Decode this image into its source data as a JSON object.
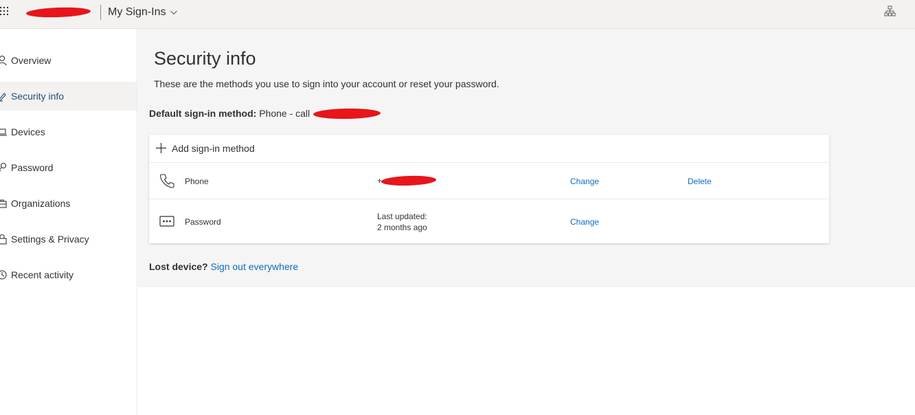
{
  "header": {
    "app_title": "My Sign-Ins",
    "icons": {
      "launcher": "waffle-icon",
      "switch": "chevron-down-icon",
      "org": "org-chart-icon"
    },
    "redacted": "account-name-redaction"
  },
  "sidebar": {
    "items": [
      {
        "label": "Overview",
        "icon": "person-icon",
        "active": false
      },
      {
        "label": "Security info",
        "icon": "pen-key-icon",
        "active": true
      },
      {
        "label": "Devices",
        "icon": "laptop-icon",
        "active": false
      },
      {
        "label": "Password",
        "icon": "key-icon",
        "active": false
      },
      {
        "label": "Organizations",
        "icon": "briefcase-icon",
        "active": false
      },
      {
        "label": "Settings & Privacy",
        "icon": "lock-icon",
        "active": false
      },
      {
        "label": "Recent activity",
        "icon": "clock-icon",
        "active": false
      }
    ]
  },
  "main": {
    "title": "Security info",
    "subtitle": "These are the methods you use to sign into your account or reset your password.",
    "default_method": {
      "label": "Default sign-in method:",
      "value": "Phone - call"
    },
    "add_method_label": "Add sign-in method",
    "methods": [
      {
        "icon": "phone-icon",
        "name": "Phone",
        "value_prefix": "+",
        "change_label": "Change",
        "delete_label": "Delete"
      },
      {
        "icon": "password-dots-icon",
        "name": "Password",
        "value_line1": "Last updated:",
        "value_line2": "2 months ago",
        "change_label": "Change"
      }
    ],
    "lost_device_label": "Lost device?",
    "sign_out_label": "Sign out everywhere"
  },
  "colors": {
    "accent": "#0f6cbd",
    "active_nav_text": "#1f4e79",
    "topbar_bg": "#f3f2f1",
    "content_bg": "#f5f5f5",
    "redaction": "#e8151b"
  }
}
